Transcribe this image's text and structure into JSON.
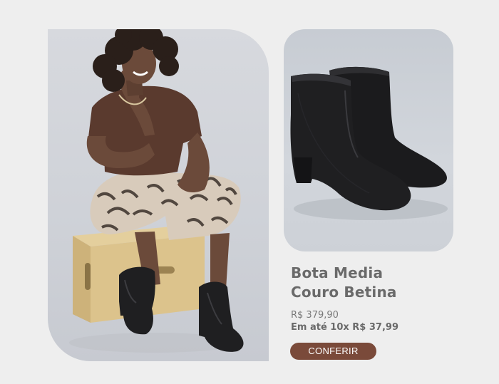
{
  "product": {
    "name_line1": "Bota Media",
    "name_line2": "Couro Betina",
    "price": "R$ 379,90",
    "installments": "Em até 10x R$ 37,99",
    "cta_label": "CONFERIR"
  },
  "colors": {
    "background": "#eeeeee",
    "cta_background": "#7a4a3a",
    "cta_text": "#ffffff",
    "title_text": "#6a6a6a"
  }
}
